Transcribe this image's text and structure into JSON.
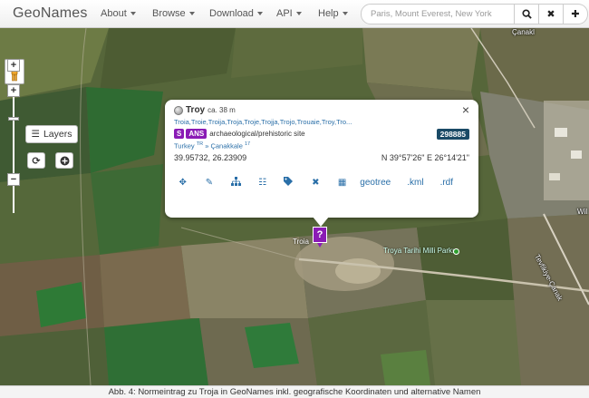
{
  "navbar": {
    "brand": "GeoNames",
    "menu": [
      {
        "label": "About"
      },
      {
        "label": "Browse"
      },
      {
        "label": "Download"
      },
      {
        "label": "API"
      },
      {
        "label": "Help"
      }
    ],
    "search_placeholder": "Paris, Mount Everest, New York",
    "search_icon": "magnifier-icon",
    "clear_icon": "close-icon",
    "add_icon": "plus-icon"
  },
  "map": {
    "layers_label": "Layers",
    "zoom_in": "+",
    "zoom_out": "−",
    "road_labels": {
      "top_right": "Çanakl",
      "right_vertical": "Tevfikiye-Çanak",
      "right_mid": "Wil"
    },
    "marker_glyph": "?",
    "marker_label": "Troia",
    "park_label": "Troya Tarihi Milli Parkı"
  },
  "popup": {
    "name": "Troy",
    "elevation": "ca. 38 m",
    "alternate_names": "Troia,Troie,Troija,Troja,Troje,Trojja,Trojo,Trouaie,Troy,Tro...",
    "feature_class": "S",
    "feature_code": "ANS",
    "feature_desc": "archaeological/prehistoric site",
    "geonameid": "298885",
    "country": "Turkey",
    "country_sup": "TR",
    "admin_sep": "»",
    "admin1": "Çanakkale",
    "admin1_sup": "17",
    "decimal_coords": "39.95732, 26.23909",
    "dms_coords": "N 39°57'26\" E 26°14'21\"",
    "toolbar_links": {
      "geotree": "geotree",
      "kml": ".kml",
      "rdf": ".rdf"
    }
  },
  "caption": "Abb. 4: Normeintrag zu Troja in GeoNames inkl. geografische Koordinaten und alternative Namen",
  "colors": {
    "brand_purple": "#8a1bb5",
    "link_blue": "#2a6fa8",
    "id_badge": "#1a4a66"
  }
}
